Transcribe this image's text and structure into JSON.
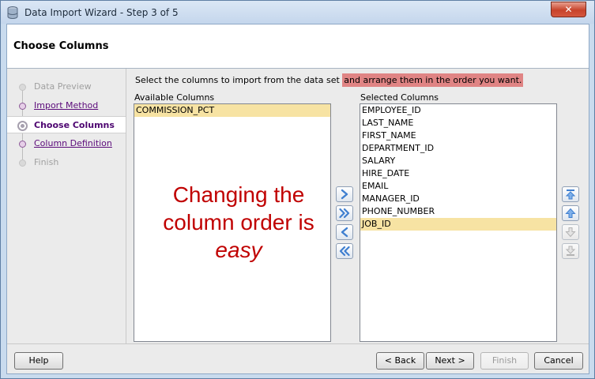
{
  "window": {
    "title": "Data Import Wizard - Step 3 of 5",
    "close_label": "✕"
  },
  "header": {
    "title": "Choose Columns"
  },
  "steps": [
    {
      "label": "Data Preview",
      "state": "disabled"
    },
    {
      "label": "Import Method",
      "state": "link"
    },
    {
      "label": "Choose Columns",
      "state": "current"
    },
    {
      "label": "Column Definition",
      "state": "link"
    },
    {
      "label": "Finish",
      "state": "disabled"
    }
  ],
  "instruction": {
    "part1": "Select the columns to import from the data set ",
    "part2": "and arrange them in the order you want."
  },
  "available": {
    "label": "Available Columns",
    "items": [
      "COMMISSION_PCT"
    ],
    "selected_index": 0
  },
  "selected": {
    "label": "Selected Columns",
    "items": [
      "EMPLOYEE_ID",
      "LAST_NAME",
      "FIRST_NAME",
      "DEPARTMENT_ID",
      "SALARY",
      "HIRE_DATE",
      "EMAIL",
      "MANAGER_ID",
      "PHONE_NUMBER",
      "JOB_ID"
    ],
    "selected_index": 9
  },
  "annotation": {
    "line1": "Changing the",
    "line2": "column order is",
    "line3": "easy"
  },
  "transfer_buttons": {
    "icons": [
      "move-right-icon",
      "move-all-right-icon",
      "move-left-icon",
      "move-all-left-icon"
    ]
  },
  "order_buttons": {
    "icons": [
      "move-to-top-icon",
      "move-up-icon",
      "move-down-icon",
      "move-to-bottom-icon"
    ]
  },
  "footer": {
    "help": "Help",
    "back": "< Back",
    "next": "Next >",
    "finish": "Finish",
    "cancel": "Cancel"
  },
  "colors": {
    "highlight": "#e08484",
    "selection": "#f7e3a3",
    "annotation": "#c00000",
    "link": "#5b0a7a",
    "arrow": "#3f7fd0"
  }
}
